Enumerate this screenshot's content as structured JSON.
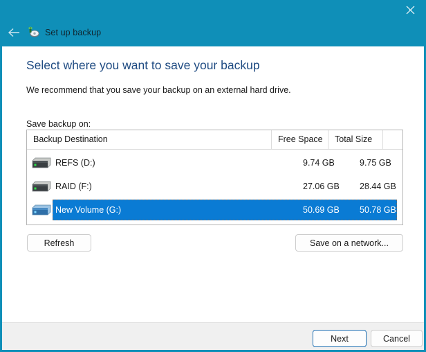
{
  "window": {
    "title": "Set up backup",
    "title_icon": "backup-disk-icon",
    "close_label": "✕",
    "back_label": "←",
    "accent_titlebar_color": "#0f8fb8"
  },
  "page": {
    "heading": "Select where you want to save your backup",
    "subheading": "We recommend that you save your backup on an external hard drive.",
    "list_label": "Save backup on:",
    "heading_color": "#1f4b82"
  },
  "destination_table": {
    "columns": [
      {
        "label": "Backup Destination"
      },
      {
        "label": "Free Space"
      },
      {
        "label": "Total Size"
      },
      {
        "label": ""
      }
    ],
    "rows": [
      {
        "name": "REFS (D:)",
        "free_space": "9.74 GB",
        "total_size": "9.75 GB",
        "icon": "hard-drive-icon",
        "selected": false
      },
      {
        "name": "RAID (F:)",
        "free_space": "27.06 GB",
        "total_size": "28.44 GB",
        "icon": "hard-drive-icon",
        "selected": false
      },
      {
        "name": "New Volume (G:)",
        "free_space": "50.69 GB",
        "total_size": "50.78 GB",
        "icon": "hard-drive-icon",
        "selected": true
      }
    ],
    "selection_color": "#0a7bd4"
  },
  "actions": {
    "refresh_label": "Refresh",
    "save_on_network_label": "Save on a network..."
  },
  "footer": {
    "next_label": "Next",
    "cancel_label": "Cancel",
    "default_button_border_color": "#1f6fb2"
  }
}
